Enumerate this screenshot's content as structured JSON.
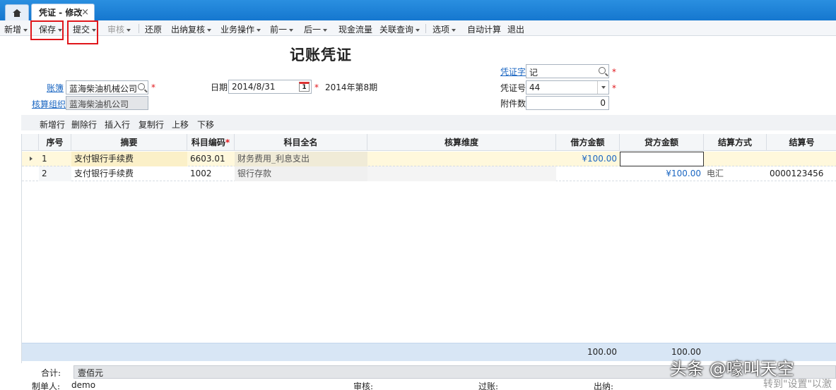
{
  "tabs": {
    "home_icon": "home-icon",
    "active": "凭证 - 修改",
    "close": "×"
  },
  "toolbar": {
    "new": "新增",
    "save": "保存",
    "submit": "提交",
    "audit": "审核",
    "restore": "还原",
    "cashier_review": "出纳复核",
    "business_ops": "业务操作",
    "prev": "前一",
    "next": "后一",
    "cash_flow": "现金流量",
    "related_query": "关联查询",
    "options": "选项",
    "auto_calc": "自动计算",
    "exit": "退出"
  },
  "header": {
    "title": "记账凭证",
    "ledger_label": "账簿",
    "ledger_value": "蓝海柴油机械公司",
    "org_label": "核算组织",
    "org_value": "蓝海柴油机公司",
    "date_label": "日期",
    "date_value": "2014/8/31",
    "calendar_day": "1",
    "period_text": "2014年第8期",
    "voucher_word_label": "凭证字",
    "voucher_word_value": "记",
    "voucher_no_label": "凭证号",
    "voucher_no_value": "44",
    "attachments_label": "附件数",
    "attachments_value": "0",
    "required_mark": "*"
  },
  "grid_toolbar": {
    "add_row": "新增行",
    "delete_row": "删除行",
    "insert_row": "插入行",
    "copy_row": "复制行",
    "move_up": "上移",
    "move_down": "下移"
  },
  "grid": {
    "columns": [
      "序号",
      "摘要",
      "科目编码",
      "科目全名",
      "核算维度",
      "借方金额",
      "贷方金额",
      "结算方式",
      "结算号"
    ],
    "rows": [
      {
        "seq": "1",
        "summary": "支付银行手续费",
        "code": "6603.01",
        "fullname": "财务费用_利息支出",
        "dimension": "",
        "debit": "¥100.00",
        "credit": "",
        "settle_method": "",
        "settle_no": ""
      },
      {
        "seq": "2",
        "summary": "支付银行手续费",
        "code": "1002",
        "fullname": "银行存款",
        "dimension": "",
        "debit": "",
        "credit": "¥100.00",
        "settle_method": "电汇",
        "settle_no": "0000123456"
      }
    ],
    "total_debit": "100.00",
    "total_credit": "100.00"
  },
  "footer": {
    "total_label": "合计:",
    "total_words": "壹佰元",
    "maker_label": "制单人:",
    "maker_value": "demo",
    "auditor_label": "审核:",
    "poster_label": "过账:",
    "cashier_label": "出纳:"
  },
  "watermark": {
    "main": "头条 @嚎叫天空",
    "sub": "转到\"设置\"以激"
  },
  "colors": {
    "tabbar": "#1d7fd6",
    "accent_red": "#e0161b",
    "link": "#1a66c2",
    "selected_row": "#fff8dc",
    "footer_bg": "#d8e6f5"
  }
}
